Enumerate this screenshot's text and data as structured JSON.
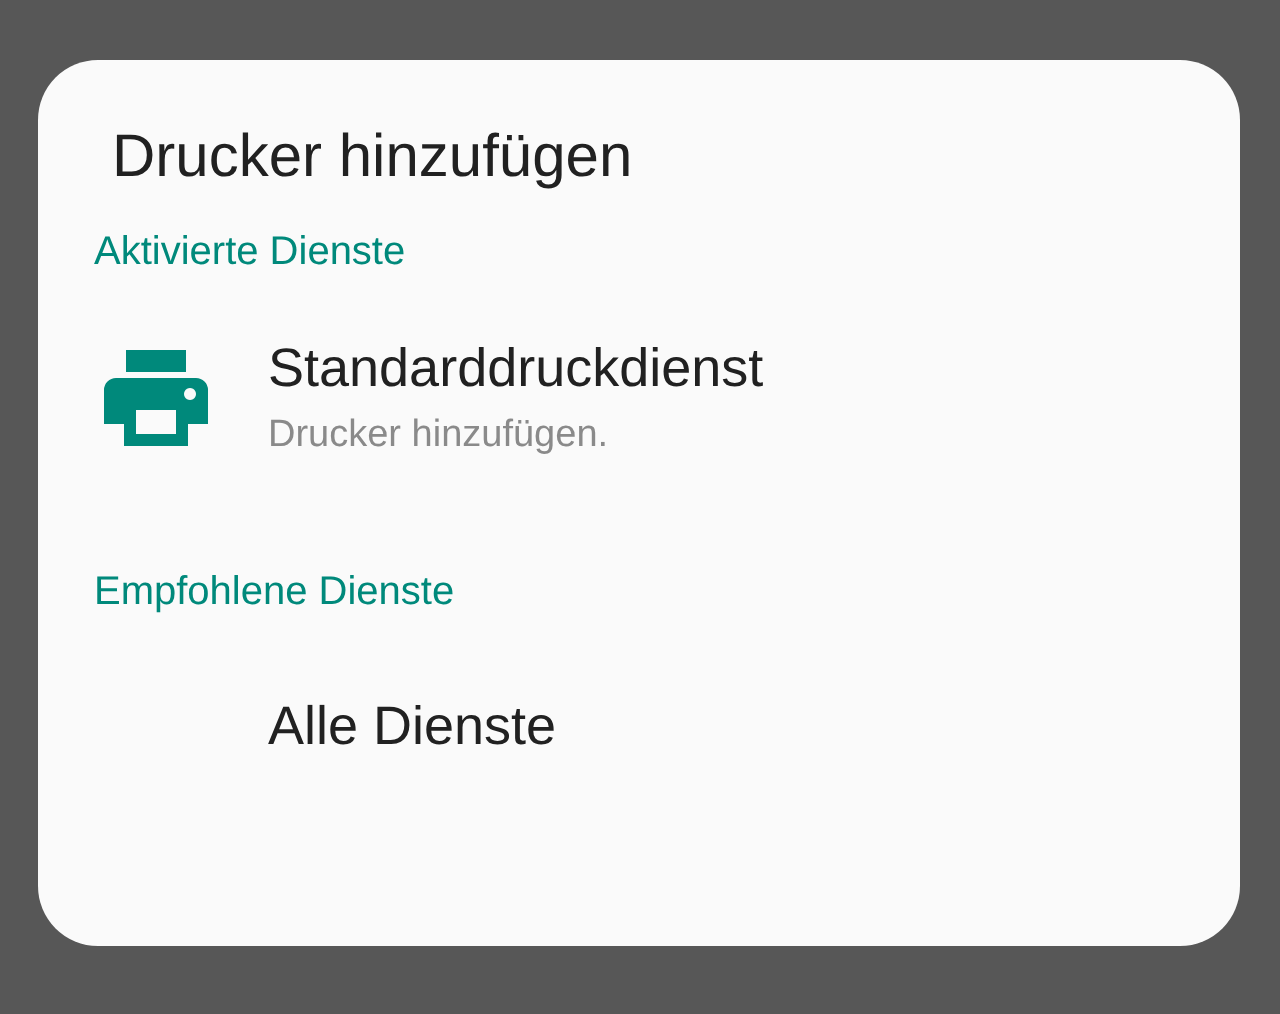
{
  "dialog": {
    "title": "Drucker hinzufügen",
    "sections": [
      {
        "header": "Aktivierte Dienste",
        "items": [
          {
            "kind": "icon",
            "title": "Standarddruckdienst",
            "subtitle": "Drucker hinzufügen."
          }
        ]
      },
      {
        "header": "Empfohlene Dienste",
        "items": [
          {
            "kind": "plain",
            "title": "Alle Dienste"
          }
        ]
      }
    ]
  }
}
